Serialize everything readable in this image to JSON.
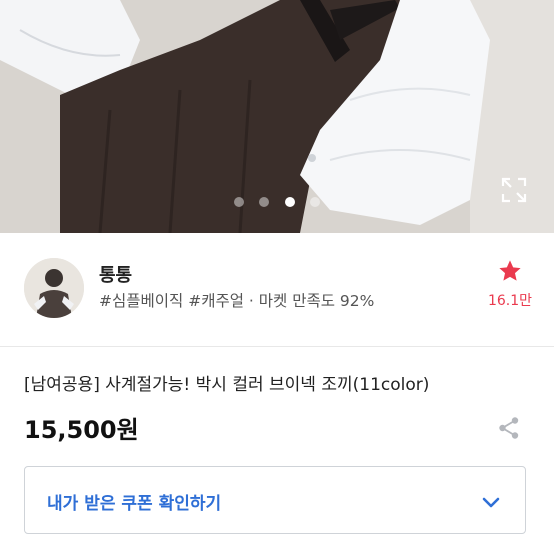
{
  "gallery": {
    "page_count": 4,
    "active_index": 2,
    "expand_icon": "expand-icon"
  },
  "shop": {
    "name": "통통",
    "tags": "#심플베이직 #캐주얼 · 마켓 만족도 92%",
    "favorite_count": "16.1만",
    "favorite_icon": "star-icon"
  },
  "product": {
    "title": "[남여공용] 사계절가능! 박시 컬러 브이넥 조끼(11color)",
    "price": "15,500원",
    "share_icon": "share-icon"
  },
  "coupon": {
    "label": "내가 받은 쿠폰 확인하기",
    "chevron_icon": "chevron-down-icon"
  },
  "colors": {
    "accent_blue": "#2f6fd6",
    "favorite_red": "#ea3a4e"
  }
}
